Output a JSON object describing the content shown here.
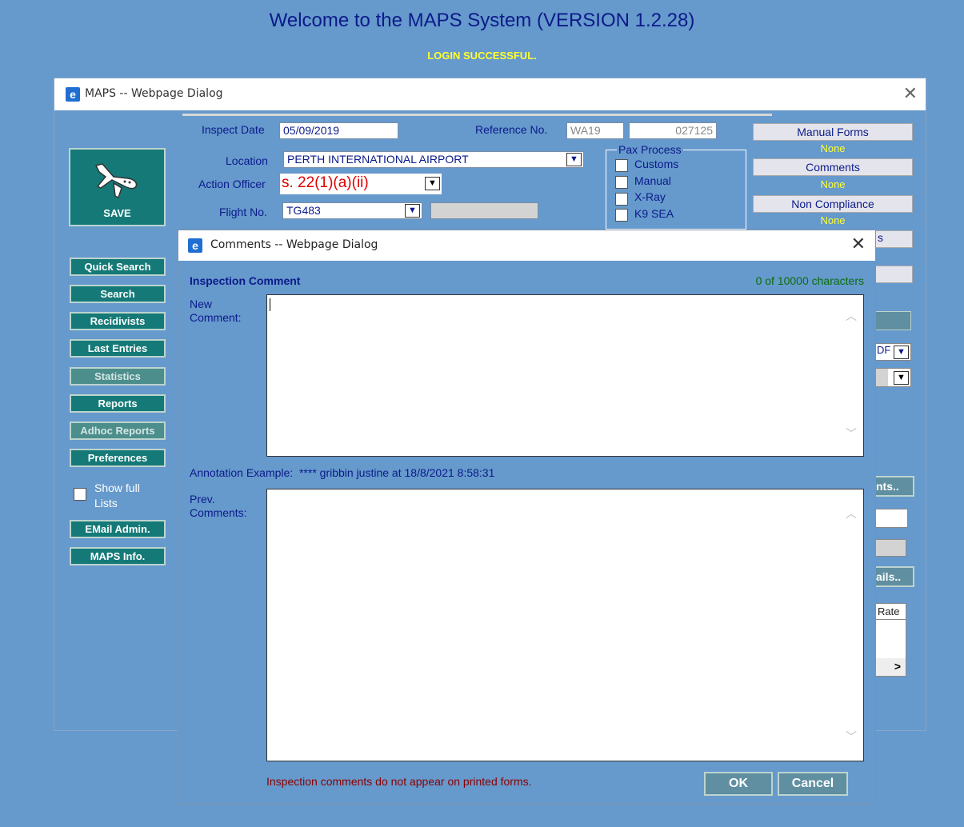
{
  "header": {
    "title": "Welcome to the MAPS System (VERSION 1.2.28)",
    "login_msg": "LOGIN SUCCESSFUL."
  },
  "outer_dialog": {
    "title": "MAPS -- Webpage Dialog",
    "save_label": "SAVE",
    "nav": [
      {
        "label": "Quick Search"
      },
      {
        "label": "Search"
      },
      {
        "label": "Recidivists"
      },
      {
        "label": "Last Entries"
      },
      {
        "label": "Statistics"
      },
      {
        "label": "Reports"
      },
      {
        "label": "Adhoc Reports"
      },
      {
        "label": "Preferences"
      }
    ],
    "show_full_lists": "Show full Lists",
    "email_admin": "EMail Admin.",
    "maps_info": "MAPS Info.",
    "form": {
      "inspect_date_label": "Inspect Date",
      "inspect_date_value": "05/09/2019",
      "reference_label": "Reference No.",
      "reference_prefix": "WA19",
      "reference_number": "027125",
      "location_label": "Location",
      "location_value": "PERTH INTERNATIONAL AIRPORT",
      "action_officer_label": "Action Officer",
      "action_officer_value": "s. 22(1)(a)(ii)",
      "flight_label": "Flight No.",
      "flight_value": "TG483"
    },
    "pax_process": {
      "legend": "Pax Process",
      "items": [
        "Customs",
        "Manual",
        "X-Ray",
        "K9 SEA"
      ]
    },
    "right_panel": {
      "manual_forms": "Manual Forms",
      "manual_forms_status": "None",
      "comments": "Comments",
      "comments_status": "None",
      "non_compliance": "Non Compliance",
      "non_compliance_status": "None",
      "fragments": [
        "s",
        "nts..",
        "ails..",
        "Rate",
        "DF",
        ">"
      ]
    }
  },
  "comments_dialog": {
    "title": "Comments -- Webpage Dialog",
    "section_label": "Inspection Comment",
    "char_count": "0 of 10000 characters",
    "new_comment_label": "New Comment:",
    "new_comment_value": "",
    "annotation_example": "Annotation Example:  **** gribbin justine at 18/8/2021 8:58:31",
    "prev_comments_label": "Prev. Comments:",
    "prev_comments_value": "",
    "footer_note": "Inspection comments do not appear on printed forms.",
    "ok_label": "OK",
    "cancel_label": "Cancel"
  },
  "colors": {
    "background": "#6699cc",
    "teal_button": "#157a77",
    "title_blue": "#0b1b8a",
    "yellow": "#ffff33",
    "green_text": "#0a6e0a",
    "dark_red": "#8b0000"
  }
}
